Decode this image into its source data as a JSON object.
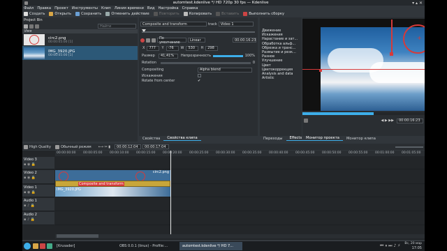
{
  "window": {
    "title": "automtest.kdenlive */ HD 720p 30 fps — Kdenlive"
  },
  "menu": [
    "Файл",
    "Правка",
    "Проект",
    "Инструменты",
    "Клип",
    "Линия времени",
    "Вид",
    "Настройка",
    "Справка"
  ],
  "toolbar": {
    "create": "Создать",
    "open": "Открыть",
    "save": "Сохранить",
    "undo": "Отменить действие",
    "redo": "Повторить",
    "copy": "Копировать",
    "paste": "Вставить",
    "render": "Выполнить сборку"
  },
  "project_bin": {
    "title": "Project Bin",
    "col_name": "Имя",
    "search_placeholder": "Найти",
    "clips": [
      {
        "name": "circ2.png",
        "duration": "00:00:05:00 [1]"
      },
      {
        "name": "IMG_3920.JPG",
        "duration": "00:00:05:00 [1]"
      }
    ]
  },
  "properties": {
    "transition": "Composite and transform",
    "track_label": "track",
    "track_value": "Video 1",
    "interp": "По умолчанию",
    "interp_type": "Linear",
    "timecode": "00:00:16:23",
    "x_label": "X",
    "x": "777",
    "y_label": "Y",
    "y": "-76",
    "w_label": "W",
    "w": "530",
    "h_label": "H",
    "h": "298",
    "size_label": "Размер",
    "size": "41,41%",
    "opacity_label": "Непрозрачность",
    "opacity": "100%",
    "rotation_label": "Rotation",
    "rotation": "0",
    "compositing_label": "Compositing",
    "compositing": "Alpha blend",
    "distort_label": "Искажения",
    "rotate_center_label": "Rotate from center",
    "tabs": [
      "Свойства",
      "Свойства клипа"
    ]
  },
  "effects": {
    "items": [
      "Движение",
      "Искажения",
      "Нарастание и зат...",
      "Обработка альф...",
      "Обрезка и транс...",
      "Размытие и резк...",
      "Разное",
      "Улучшение",
      "Цвет",
      "Цветокоррекция",
      "Analysis and data",
      "Artistic"
    ],
    "tabs": [
      "Переходы",
      "Effects"
    ]
  },
  "monitor": {
    "timecode": "00:00:16:23",
    "tabs": [
      "Монитор проекта",
      "Монитор клипа"
    ]
  },
  "timeline": {
    "quality": "High Quality",
    "mode": "Обычный режим",
    "position": "00:00:12:04",
    "duration": "00:00:17:04",
    "ruler": [
      "00:00:00:00",
      "00:00:05:00",
      "00:00:10:00",
      "00:00:15:00",
      "00:00:20:00",
      "00:00:25:00",
      "00:00:30:00",
      "00:00:35:00",
      "00:00:40:00",
      "00:00:45:00",
      "00:00:50:00",
      "00:00:55:00",
      "00:01:00:00",
      "00:01:05:00"
    ],
    "tracks": [
      "Video 3",
      "Video 2",
      "Video 1",
      "Audio 1",
      "Audio 2"
    ],
    "clip_circ2": "circ2.png",
    "clip_img": "IMG_3920.JPG",
    "transition_label": "Composite and transform"
  },
  "taskbar": {
    "tasks": [
      "[Krusader]",
      "OBS 0.0.1 (linux) - Profile:...",
      "automtest.kdenlive */ HD 7..."
    ],
    "clock_day": "Вс, 20 мар",
    "clock_time": "17:05"
  },
  "colors": {
    "accent": "#3daee9",
    "clip_blue": "#3d6d99",
    "transition_yellow": "#c8a63a",
    "marker_red": "#d63a3a"
  }
}
